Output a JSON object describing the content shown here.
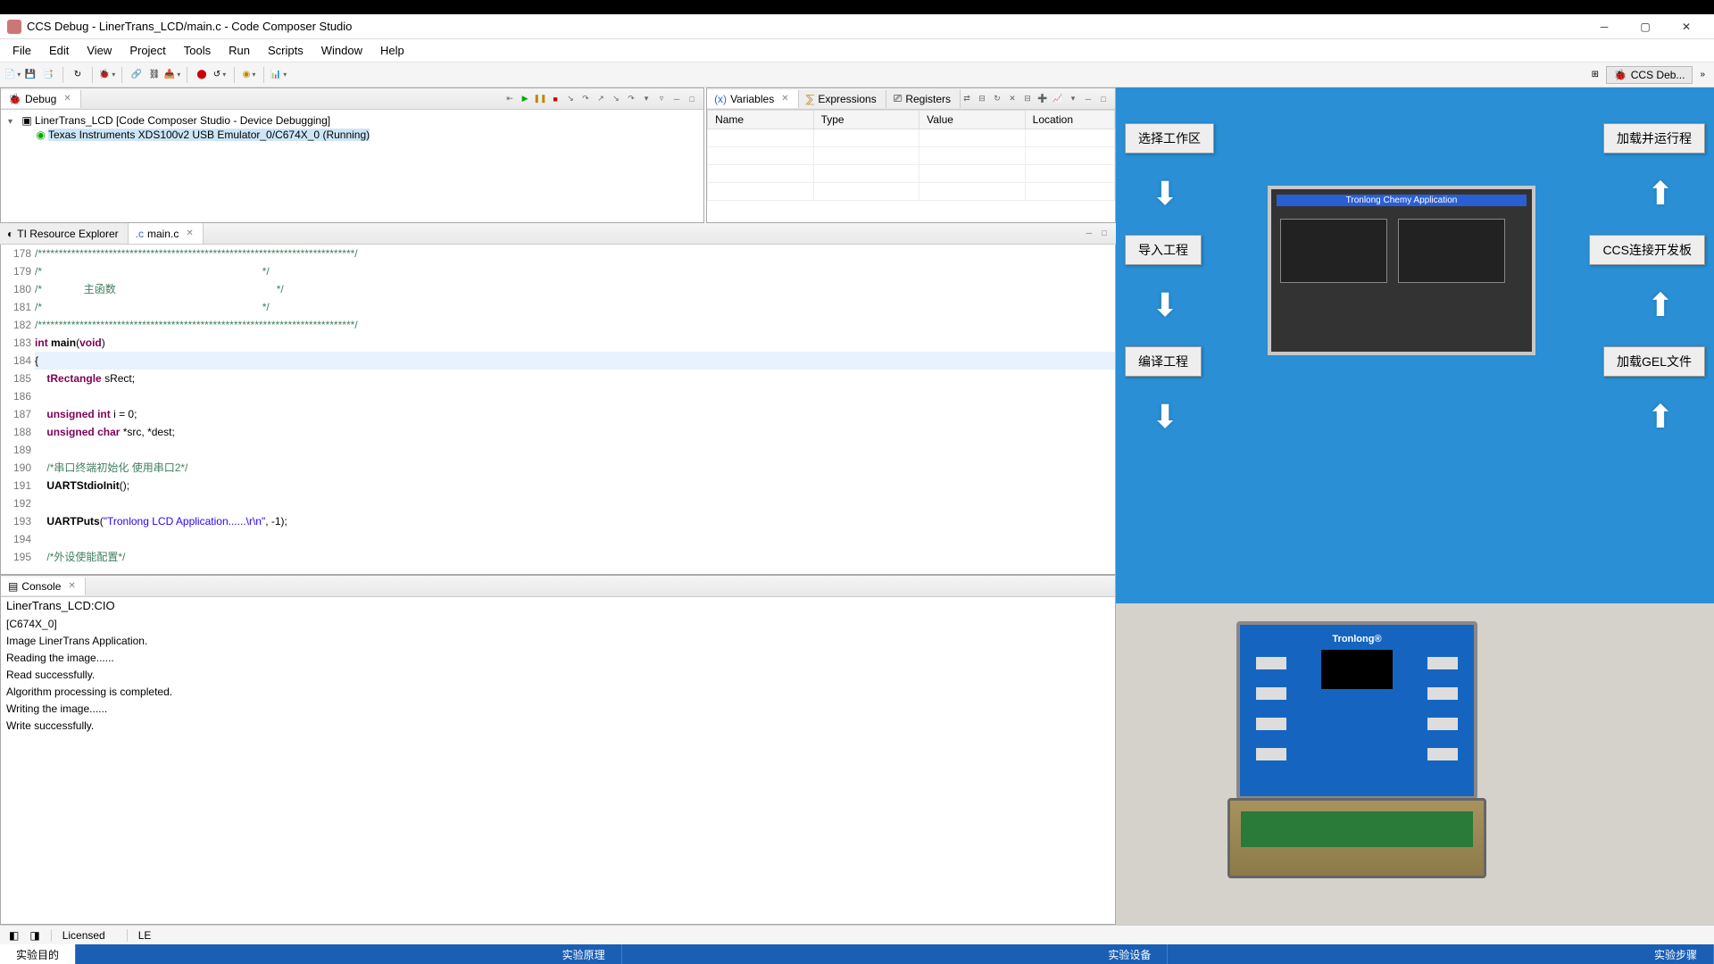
{
  "window": {
    "title": "CCS Debug - LinerTrans_LCD/main.c - Code Composer Studio"
  },
  "menu": [
    "File",
    "Edit",
    "View",
    "Project",
    "Tools",
    "Run",
    "Scripts",
    "Window",
    "Help"
  ],
  "perspective": {
    "label": "CCS Deb..."
  },
  "debug": {
    "tab": "Debug",
    "root": "LinerTrans_LCD [Code Composer Studio - Device Debugging]",
    "child": "Texas Instruments XDS100v2 USB Emulator_0/C674X_0 (Running)"
  },
  "vars": {
    "tabs": [
      "Variables",
      "Expressions",
      "Registers"
    ],
    "cols": [
      "Name",
      "Type",
      "Value",
      "Location"
    ]
  },
  "editor": {
    "tabs": {
      "resource": "TI Resource Explorer",
      "main": "main.c"
    },
    "lines": [
      "178",
      "179",
      "180",
      "181",
      "182",
      "183",
      "184",
      "185",
      "186",
      "187",
      "188",
      "189",
      "190",
      "191",
      "192",
      "193",
      "194",
      "195"
    ],
    "c1": "/****************************************************************************/",
    "c2": "/*                                                                          */",
    "c3": "/*              主函数                                                      */",
    "c4": "/*                                                                          */",
    "c5": "/****************************************************************************/",
    "k_int": "int",
    "fn_main": "main",
    "k_void": "void",
    "brace_o": "{",
    "t_rect": "tRectangle",
    "v_srect": " sRect;",
    "k_unsigned": "unsigned",
    "k_int2": "int",
    "v_i": " i = 0;",
    "k_char": "char",
    "v_src": " *src, *dest;",
    "cm_uart": "/*串口终端初始化 使用串口2*/",
    "fn_init": "UARTStdioInit",
    "call_init": "();",
    "fn_puts": "UARTPuts",
    "str_app": "\"Tronlong LCD Application......\\r\\n\"",
    "puts_tail": ", -1);",
    "cm_periph": "/*外设使能配置*/"
  },
  "console": {
    "tab": "Console",
    "title": "LinerTrans_LCD:CIO",
    "l1": "[C674X_0]",
    "l2": "Image LinerTrans Application.",
    "l3": "Reading the image......",
    "l4": "Read successfully.",
    "l5": "Algorithm processing is completed.",
    "l6": "Writing the image......",
    "l7": "Write successfully."
  },
  "status": {
    "lic": "Licensed",
    "le": "LE"
  },
  "footer": {
    "t1": "实验目的",
    "t2": "实验原理",
    "t3": "实验设备",
    "t4": "实验步骤"
  },
  "flow": {
    "b1": "选择工作区",
    "b2": "导入工程",
    "b3": "编译工程",
    "b4": "加载并运行程",
    "b5": "CCS连接开发板",
    "b6": "加载GEL文件",
    "screen_title": "Tronlong Chemy Application"
  },
  "case": {
    "brand": "Tronlong®"
  }
}
